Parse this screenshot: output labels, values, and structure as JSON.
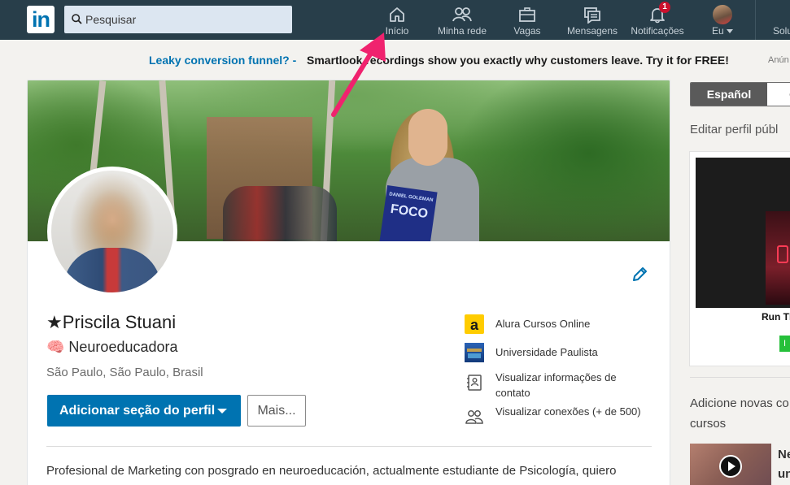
{
  "nav": {
    "logo": "in",
    "search_placeholder": "Pesquisar",
    "items": [
      {
        "label": "Início",
        "icon": "home-icon"
      },
      {
        "label": "Minha rede",
        "icon": "network-icon"
      },
      {
        "label": "Vagas",
        "icon": "briefcase-icon"
      },
      {
        "label": "Mensagens",
        "icon": "messages-icon"
      },
      {
        "label": "Notificações",
        "icon": "bell-icon",
        "badge": "1"
      },
      {
        "label": "Eu",
        "icon": "avatar"
      }
    ],
    "overflow_label": "Solu"
  },
  "banner": {
    "link": "Leaky conversion funnel? -",
    "text": "Smartlook recordings show you exactly why customers leave. Try it for FREE!",
    "ad_label": "Anún"
  },
  "cover": {
    "book_author": "DANIEL GOLEMAN",
    "book_title": "FOCO"
  },
  "profile": {
    "name": "★Priscila Stuani",
    "headline": "🧠 Neuroeducadora",
    "location": "São Paulo, São Paulo, Brasil",
    "primary_button": "Adicionar seção do perfil",
    "more_button": "Mais...",
    "side_items": [
      {
        "icon": "alura-logo-icon",
        "label": "Alura Cursos Online"
      },
      {
        "icon": "university-logo-icon",
        "label": "Universidade Paulista"
      },
      {
        "icon": "contact-card-icon",
        "label": "Visualizar informações de contato"
      },
      {
        "icon": "connections-icon",
        "label": "Visualizar conexões (+ de 500)"
      }
    ],
    "summary": "Profesional de Marketing con posgrado en neuroeducación, actualmente estudiante de Psicología, quiero"
  },
  "right": {
    "lang_active": "Español",
    "lang_other": "O",
    "edit_public": "Editar perfil públ",
    "ad_title": "Run Th",
    "ad_cta": "I",
    "add_new": "Adicione novas co cursos",
    "course_title": "Ne un"
  },
  "colors": {
    "nav_bg": "#283e4a",
    "brand_blue": "#0073b1",
    "badge_red": "#cb112d",
    "annotation_arrow": "#f0226e"
  }
}
